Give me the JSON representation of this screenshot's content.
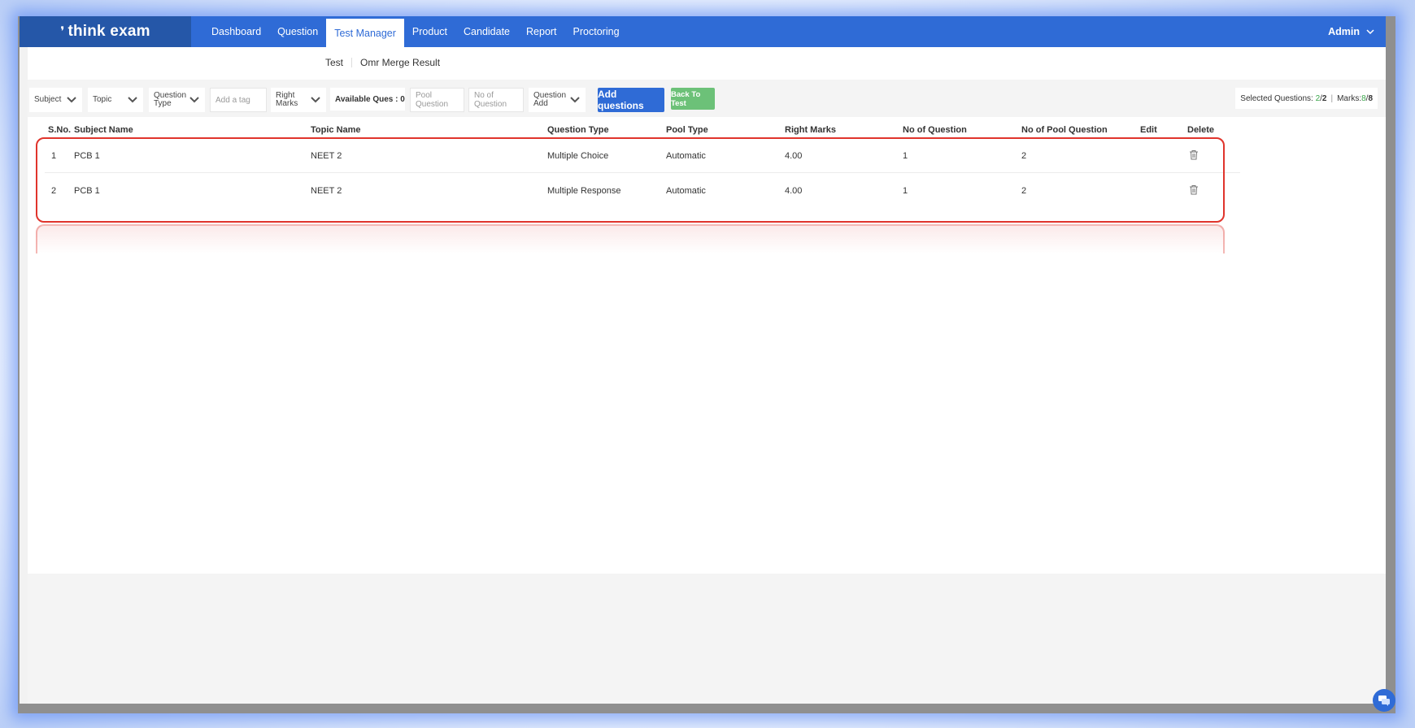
{
  "brand": {
    "name": "think exam",
    "mark": "❜"
  },
  "nav": {
    "items": [
      {
        "label": "Dashboard",
        "active": false
      },
      {
        "label": "Question",
        "active": false
      },
      {
        "label": "Test Manager",
        "active": true
      },
      {
        "label": "Product",
        "active": false
      },
      {
        "label": "Candidate",
        "active": false
      },
      {
        "label": "Report",
        "active": false
      },
      {
        "label": "Proctoring",
        "active": false
      }
    ],
    "user": "Admin"
  },
  "breadcrumb": [
    "Test",
    "Omr Merge Result"
  ],
  "filters": {
    "subject": "Subject",
    "topic": "Topic",
    "question_type_line1": "Question",
    "question_type_line2": "Type",
    "tag_placeholder": "Add a tag",
    "right_marks_line1": "Right",
    "right_marks_line2": "Marks",
    "available": "Available Ques : 0",
    "pool_placeholder": "Pool Question",
    "noq_placeholder": "No of Question",
    "question_add_line1": "Question",
    "question_add_line2": "Add",
    "add_button": "Add questions",
    "back_button": "Back To Test"
  },
  "selection": {
    "label": "Selected Questions:",
    "selected": "2",
    "slash": "/",
    "total": "2",
    "pipe": "|",
    "marks_label": "Marks:",
    "marks_selected": "8",
    "marks_total": "8"
  },
  "table": {
    "headers": [
      "S.No.",
      "Subject Name",
      "Topic Name",
      "Question Type",
      "Pool Type",
      "Right Marks",
      "No of Question",
      "No of Pool Question",
      "Edit",
      "Delete"
    ],
    "rows": [
      {
        "sno": "1",
        "subject": "PCB 1",
        "topic": "NEET 2",
        "qtype": "Multiple Choice",
        "pool": "Automatic",
        "marks": "4.00",
        "noq": "1",
        "nopool": "2"
      },
      {
        "sno": "2",
        "subject": "PCB 1",
        "topic": "NEET 2",
        "qtype": "Multiple Response",
        "pool": "Automatic",
        "marks": "4.00",
        "noq": "1",
        "nopool": "2"
      }
    ]
  },
  "colors": {
    "primary": "#2f6bd6",
    "logo_bg": "#2557a8",
    "back_btn": "#6cc178",
    "highlight": "#e0342c",
    "selected_green": "#3aa64a"
  }
}
